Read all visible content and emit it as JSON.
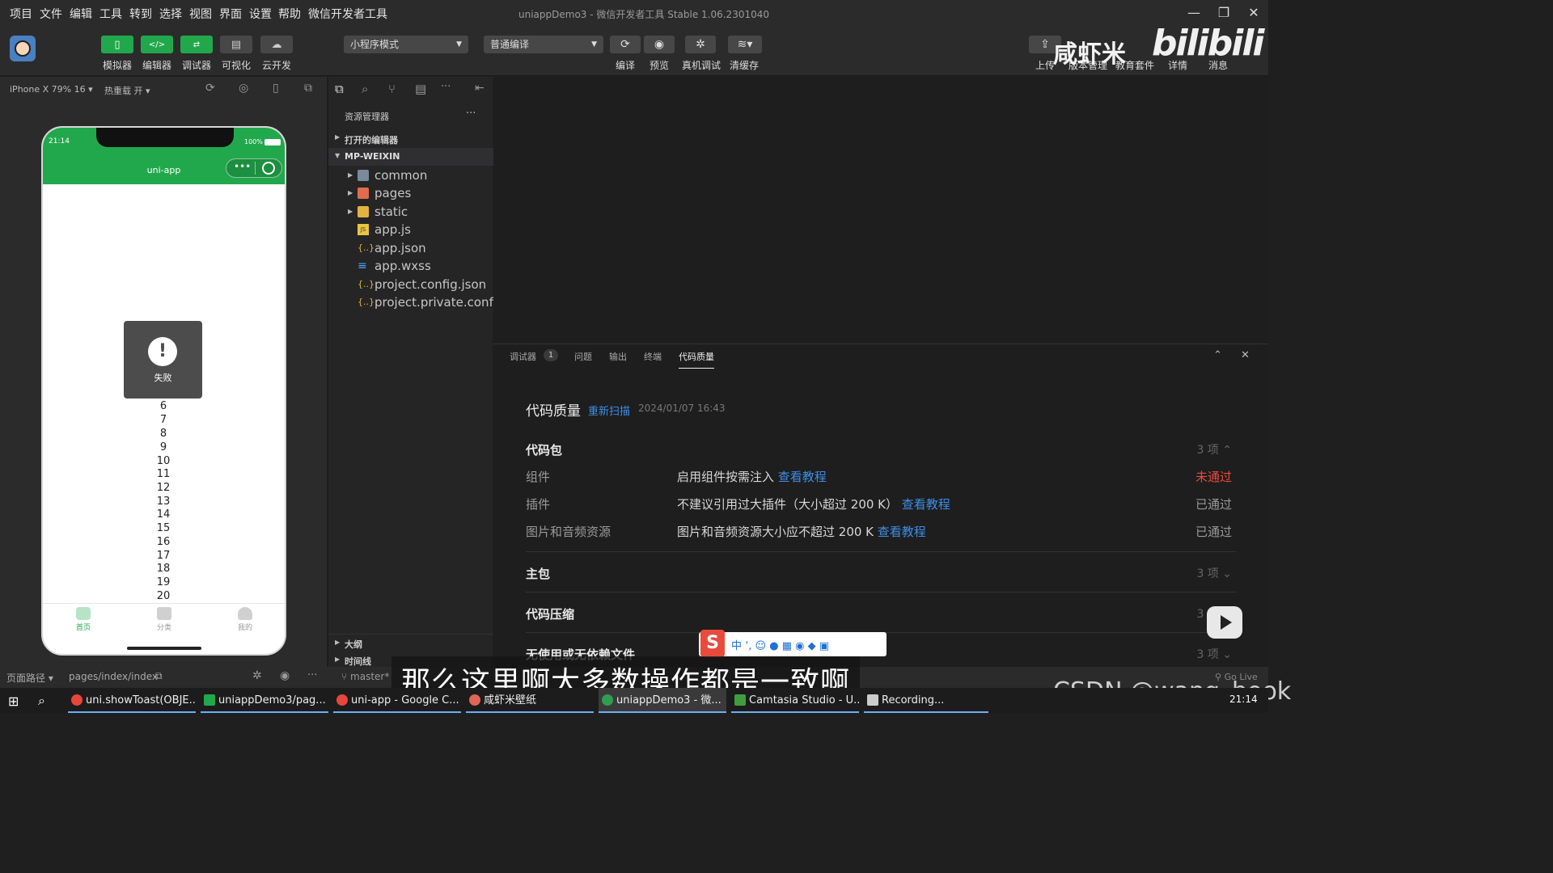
{
  "menu": [
    "项目",
    "文件",
    "编辑",
    "工具",
    "转到",
    "选择",
    "视图",
    "界面",
    "设置",
    "帮助",
    "微信开发者工具"
  ],
  "window_title": "uniappDemo3 - 微信开发者工具 Stable 1.06.2301040",
  "toolbar": {
    "left_buttons": [
      "模拟器",
      "编辑器",
      "调试器",
      "可视化",
      "云开发"
    ],
    "mode_select": "小程序模式",
    "compile_select": "普通编译",
    "center_buttons": [
      "编译",
      "预览",
      "真机调试",
      "清缓存"
    ],
    "right_buttons": [
      "上传",
      "版本管理",
      "教育套件",
      "详情",
      "消息"
    ]
  },
  "simulator": {
    "device": "iPhone X 79% 16",
    "hot_reload": "热重载 开",
    "time": "21:14",
    "battery": "100%",
    "nav_title": "uni-app",
    "toast_text": "失败",
    "toast_icon": "!",
    "list_numbers": [
      "6",
      "7",
      "8",
      "9",
      "10",
      "11",
      "12",
      "13",
      "14",
      "15",
      "16",
      "17",
      "18",
      "19",
      "20"
    ],
    "tabs": [
      "首页",
      "分类",
      "我的"
    ]
  },
  "explorer": {
    "title": "资源管理器",
    "more": "···",
    "open_editors": "打开的编辑器",
    "project": "MP-WEIXIN",
    "items": [
      {
        "name": "common",
        "type": "folder"
      },
      {
        "name": "pages",
        "type": "folder"
      },
      {
        "name": "static",
        "type": "folder"
      },
      {
        "name": "app.js",
        "type": "js"
      },
      {
        "name": "app.json",
        "type": "json"
      },
      {
        "name": "app.wxss",
        "type": "wxss"
      },
      {
        "name": "project.config.json",
        "type": "json"
      },
      {
        "name": "project.private.confi...",
        "type": "json"
      }
    ],
    "outline": "大纲",
    "timeline": "时间线",
    "branch": "master*"
  },
  "panel": {
    "tabs": [
      "调试器",
      "问题",
      "输出",
      "终端",
      "代码质量"
    ],
    "debugger_badge": "1",
    "active_tab": "代码质量",
    "title": "代码质量",
    "rescan": "重新扫描",
    "timestamp": "2024/01/07 16:43",
    "package_section": "代码包",
    "package_count": "3 项",
    "rows": [
      {
        "label": "组件",
        "desc": "启用组件按需注入",
        "link": "查看教程",
        "status": "未通过",
        "fail": true
      },
      {
        "label": "插件",
        "desc": "不建议引用过大插件（大小超过 200 K）",
        "link": "查看教程",
        "status": "已通过",
        "fail": false
      },
      {
        "label": "图片和音频资源",
        "desc": "图片和音频资源大小应不超过 200 K",
        "link": "查看教程",
        "status": "已通过",
        "fail": false
      }
    ],
    "sections": [
      {
        "name": "主包",
        "count": "3 项"
      },
      {
        "name": "代码压缩",
        "count": "3 项"
      },
      {
        "name": "无使用或无依赖文件",
        "count": "3 项"
      }
    ]
  },
  "statusbar": {
    "page_path_label": "页面路径",
    "page_path": "pages/index/index",
    "golive": "Go Live"
  },
  "taskbar": {
    "items": [
      "uni.showToast(OBJE...",
      "uniappDemo3/pag...",
      "uni-app - Google C...",
      "咸虾米壁纸",
      "uniappDemo3 - 微...",
      "Camtasia Studio - U...",
      "Recording..."
    ],
    "clock": "21:14"
  },
  "overlay": {
    "subtitle": "那么这里啊大多数操作都是一致啊",
    "watermark": "CSDN @wang_book",
    "brand": "咸虾米",
    "bili_logo": "bilibili"
  },
  "colors": {
    "accent_green": "#22a84c",
    "link_blue": "#3e8ee8",
    "fail_red": "#e84b3c"
  }
}
